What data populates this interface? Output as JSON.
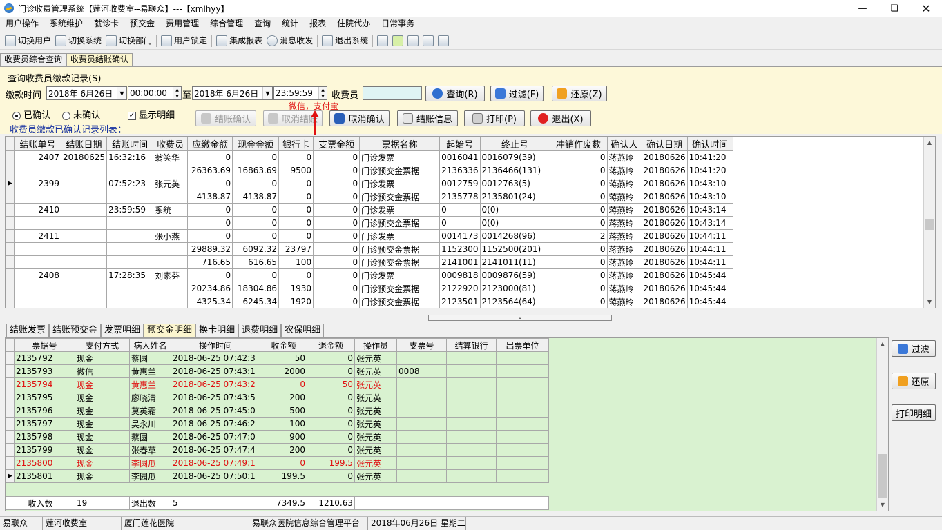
{
  "window": {
    "title": "门诊收费管理系统【莲河收费室--易联众】---【xmlhyy】"
  },
  "menu": [
    "用户操作",
    "系统维护",
    "就诊卡",
    "预交金",
    "费用管理",
    "综合管理",
    "查询",
    "统计",
    "报表",
    "住院代办",
    "日常事务"
  ],
  "toolbar": {
    "items": [
      "切换用户",
      "切换系统",
      "切换部门",
      "用户锁定",
      "集成报表",
      "消息收发",
      "退出系统"
    ]
  },
  "tabs": [
    "收费员综合查询",
    "收费员结账确认"
  ],
  "query": {
    "group_title": "查询收费员缴款记录(S)",
    "time_label": "缴款时间",
    "start_date": "2018年 6月26日",
    "start_time": "00:00:00",
    "to_label": "至",
    "end_date": "2018年 6月26日",
    "end_time": "23:59:59",
    "cashier_label": "收费员",
    "cashier_value": "",
    "btn_query": "查询(R)",
    "btn_filter": "过滤(F)",
    "btn_restore": "还原(Z)",
    "radio_confirmed": "已确认",
    "radio_unconfirmed": "未确认",
    "check_detail": "显示明细",
    "btn_settle_confirm": "结账确认",
    "btn_cancel_settle": "取消结账",
    "btn_cancel_confirm": "取消确认",
    "btn_settle_info": "结账信息",
    "btn_print": "打印(P)",
    "btn_exit": "退出(X)",
    "annotation": "微信，支付宝",
    "list_label": "收费员缴款已确认记录列表："
  },
  "grid1": {
    "columns": [
      "结账单号",
      "结账日期",
      "结账时间",
      "收费员",
      "应缴金额",
      "现金金额",
      "银行卡",
      "支票金额",
      "票据名称",
      "起始号",
      "终止号",
      "冲销作废数",
      "确认人",
      "确认日期",
      "确认时间"
    ],
    "rows": [
      [
        "",
        "2407",
        "20180625",
        "16:32:16",
        "翁笑华",
        "0",
        "0",
        "0",
        "0",
        "门诊发票",
        "0016041",
        "0016079(39)",
        "0",
        "蒋燕玲",
        "20180626",
        "10:41:20"
      ],
      [
        "",
        "",
        "",
        "",
        "",
        "26363.69",
        "16863.69",
        "9500",
        "0",
        "门诊预交金票据",
        "2136336",
        "2136466(131)",
        "0",
        "蒋燕玲",
        "20180626",
        "10:41:20"
      ],
      [
        "▶",
        "2399",
        "",
        "07:52:23",
        "张元英",
        "0",
        "0",
        "0",
        "0",
        "门诊发票",
        "0012759",
        "0012763(5)",
        "0",
        "蒋燕玲",
        "20180626",
        "10:43:10"
      ],
      [
        "",
        "",
        "",
        "",
        "",
        "4138.87",
        "4138.87",
        "0",
        "0",
        "门诊预交金票据",
        "2135778",
        "2135801(24)",
        "0",
        "蒋燕玲",
        "20180626",
        "10:43:10"
      ],
      [
        "",
        "2410",
        "",
        "23:59:59",
        "系统",
        "0",
        "0",
        "0",
        "0",
        "门诊发票",
        "0",
        "0(0)",
        "0",
        "蒋燕玲",
        "20180626",
        "10:43:14"
      ],
      [
        "",
        "",
        "",
        "",
        "",
        "0",
        "0",
        "0",
        "0",
        "门诊预交金票据",
        "0",
        "0(0)",
        "0",
        "蒋燕玲",
        "20180626",
        "10:43:14"
      ],
      [
        "",
        "2411",
        "",
        "",
        "张小燕",
        "0",
        "0",
        "0",
        "0",
        "门诊发票",
        "0014173",
        "0014268(96)",
        "2",
        "蒋燕玲",
        "20180626",
        "10:44:11"
      ],
      [
        "",
        "",
        "",
        "",
        "",
        "29889.32",
        "6092.32",
        "23797",
        "0",
        "门诊预交金票据",
        "1152300",
        "1152500(201)",
        "0",
        "蒋燕玲",
        "20180626",
        "10:44:11"
      ],
      [
        "",
        "",
        "",
        "",
        "",
        "716.65",
        "616.65",
        "100",
        "0",
        "门诊预交金票据",
        "2141001",
        "2141011(11)",
        "0",
        "蒋燕玲",
        "20180626",
        "10:44:11"
      ],
      [
        "",
        "2408",
        "",
        "17:28:35",
        "刘素芬",
        "0",
        "0",
        "0",
        "0",
        "门诊发票",
        "0009818",
        "0009876(59)",
        "0",
        "蒋燕玲",
        "20180626",
        "10:45:44"
      ],
      [
        "",
        "",
        "",
        "",
        "",
        "20234.86",
        "18304.86",
        "1930",
        "0",
        "门诊预交金票据",
        "2122920",
        "2123000(81)",
        "0",
        "蒋燕玲",
        "20180626",
        "10:45:44"
      ],
      [
        "",
        "",
        "",
        "",
        "",
        "-4325.34",
        "-6245.34",
        "1920",
        "0",
        "门诊预交金票据",
        "2123501",
        "2123564(64)",
        "0",
        "蒋燕玲",
        "20180626",
        "10:45:44"
      ]
    ]
  },
  "detail_tabs": [
    "结账发票",
    "结账预交金",
    "发票明细",
    "预交金明细",
    "换卡明细",
    "退费明细",
    "农保明细"
  ],
  "grid2": {
    "columns": [
      "票据号",
      "支付方式",
      "病人姓名",
      "操作时间",
      "收金额",
      "退金额",
      "操作员",
      "支票号",
      "结算银行",
      "出票单位"
    ],
    "rows": [
      [
        "",
        "2135792",
        "现金",
        "蔡圆",
        "2018-06-25 07:42:3",
        "50",
        "0",
        "张元英",
        "",
        "",
        ""
      ],
      [
        "",
        "2135793",
        "微信",
        "黄惠兰",
        "2018-06-25 07:43:1",
        "2000",
        "0",
        "张元英",
        "0008",
        "",
        ""
      ],
      [
        "",
        "2135794",
        "现金",
        "黄惠兰",
        "2018-06-25 07:43:2",
        "0",
        "50",
        "张元英",
        "",
        "",
        ""
      ],
      [
        "",
        "2135795",
        "现金",
        "廖晓清",
        "2018-06-25 07:43:5",
        "200",
        "0",
        "张元英",
        "",
        "",
        ""
      ],
      [
        "",
        "2135796",
        "现金",
        "莫英霜",
        "2018-06-25 07:45:0",
        "500",
        "0",
        "张元英",
        "",
        "",
        ""
      ],
      [
        "",
        "2135797",
        "现金",
        "吴永川",
        "2018-06-25 07:46:2",
        "100",
        "0",
        "张元英",
        "",
        "",
        ""
      ],
      [
        "",
        "2135798",
        "现金",
        "蔡圆",
        "2018-06-25 07:47:0",
        "900",
        "0",
        "张元英",
        "",
        "",
        ""
      ],
      [
        "",
        "2135799",
        "现金",
        "张春草",
        "2018-06-25 07:47:4",
        "200",
        "0",
        "张元英",
        "",
        "",
        ""
      ],
      [
        "",
        "2135800",
        "现金",
        "李圆瓜",
        "2018-06-25 07:49:1",
        "0",
        "199.5",
        "张元英",
        "",
        "",
        ""
      ],
      [
        "▶",
        "2135801",
        "现金",
        "李园瓜",
        "2018-06-25 07:50:1",
        "199.5",
        "0",
        "张元英",
        "",
        "",
        ""
      ]
    ],
    "footer": {
      "in_label": "收入数",
      "in_count": "19",
      "out_label": "退出数",
      "out_count": "5",
      "sum_in": "7349.5",
      "sum_out": "1210.63"
    }
  },
  "right_buttons": {
    "filter": "过滤",
    "restore": "还原",
    "print_detail": "打印明细"
  },
  "status": [
    "易联众",
    "莲河收费室",
    "厦门莲花医院",
    "易联众医院信息综合管理平台",
    "2018年06月26日  星期二"
  ]
}
